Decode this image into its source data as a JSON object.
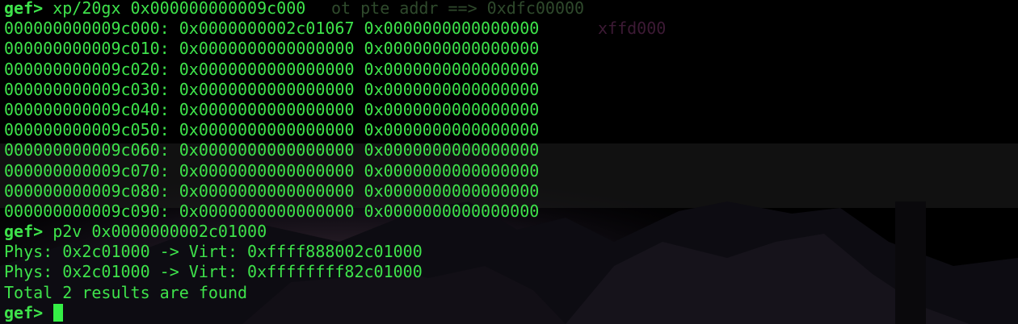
{
  "terminal": {
    "prompt": "gef>",
    "command1": "xp/20gx 0x000000000009c000",
    "dump": [
      {
        "addr": "000000000009c000:",
        "v1": "0x0000000002c01067",
        "v2": "0x0000000000000000"
      },
      {
        "addr": "000000000009c010:",
        "v1": "0x0000000000000000",
        "v2": "0x0000000000000000"
      },
      {
        "addr": "000000000009c020:",
        "v1": "0x0000000000000000",
        "v2": "0x0000000000000000"
      },
      {
        "addr": "000000000009c030:",
        "v1": "0x0000000000000000",
        "v2": "0x0000000000000000"
      },
      {
        "addr": "000000000009c040:",
        "v1": "0x0000000000000000",
        "v2": "0x0000000000000000"
      },
      {
        "addr": "000000000009c050:",
        "v1": "0x0000000000000000",
        "v2": "0x0000000000000000"
      },
      {
        "addr": "000000000009c060:",
        "v1": "0x0000000000000000",
        "v2": "0x0000000000000000"
      },
      {
        "addr": "000000000009c070:",
        "v1": "0x0000000000000000",
        "v2": "0x0000000000000000"
      },
      {
        "addr": "000000000009c080:",
        "v1": "0x0000000000000000",
        "v2": "0x0000000000000000"
      },
      {
        "addr": "000000000009c090:",
        "v1": "0x0000000000000000",
        "v2": "0x0000000000000000"
      }
    ],
    "command2": "p2v 0x0000000002c01000",
    "results": [
      "Phys: 0x2c01000 -> Virt: 0xffff888002c01000",
      "Phys: 0x2c01000 -> Virt: 0xffffffff82c01000"
    ],
    "summary": "Total 2 results are found",
    "ghost_text_1": "ot pte addr ==> 0xdfc00000",
    "ghost_text_2": "xffd000",
    "colors": {
      "text": "#3ee34b",
      "cursor": "#35f046",
      "background": "#000000"
    }
  }
}
